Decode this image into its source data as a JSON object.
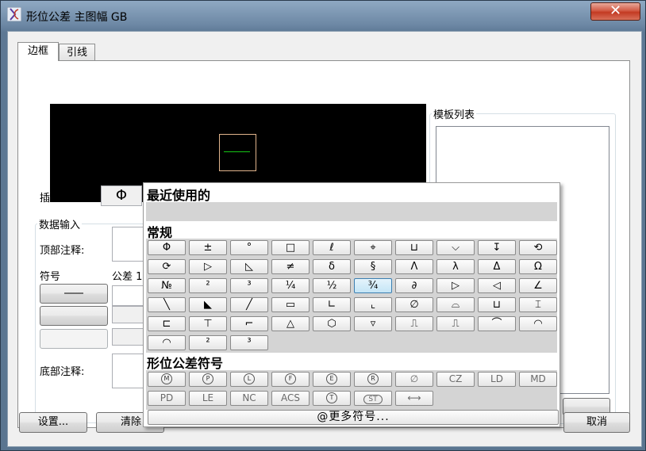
{
  "window": {
    "title": "形位公差 主图幅 GB",
    "close_glyph": "✕"
  },
  "tabs": [
    {
      "label": "边框"
    },
    {
      "label": "引线"
    }
  ],
  "form": {
    "insert_label": "插入符",
    "insert_symbol": "Φ",
    "data_input_group": "数据输入",
    "top_note_label": "顶部注释:",
    "symbol_label": "符号",
    "tolerance_label": "公差 1",
    "bottom_note_label": "底部注释:",
    "template_list_label": "模板列表"
  },
  "buttons": {
    "settings": "设置...",
    "clear": "清除",
    "cancel": "取消"
  },
  "popup": {
    "recent_title": "最近使用的",
    "normal_title": "常规",
    "gdt_title": "形位公差符号",
    "more_label": "@更多符号...",
    "normal_rows": [
      [
        "Φ",
        "±",
        "°",
        "□",
        "ℓ",
        "⌖",
        "⊔",
        "⌵",
        "↧",
        "⟲"
      ],
      [
        "⟳",
        "▷",
        "◺",
        "≠",
        "δ",
        "§",
        "Λ",
        "λ",
        "Δ",
        "Ω"
      ],
      [
        "№",
        "²",
        "³",
        "¼",
        "½",
        "¾",
        "∂",
        "▷",
        "◁",
        "∠"
      ],
      [
        "╲",
        "◣",
        "╱",
        "▭",
        "∟",
        "⌞",
        "∅",
        "⌓",
        "⊔",
        "⌶"
      ],
      [
        "⊏",
        "⊤",
        "⌐",
        "△",
        "⬡",
        "▿",
        "⎍",
        "⎍",
        "⌒",
        "◠"
      ],
      [
        "◠",
        "²",
        "³"
      ]
    ],
    "gdt_rows": [
      [
        "M",
        "P",
        "L",
        "F",
        "E",
        "R",
        "∅",
        "CZ",
        "LD",
        "MD"
      ],
      [
        "PD",
        "LE",
        "NC",
        "ACS",
        "T",
        "ST",
        "⟷"
      ]
    ]
  },
  "colors": {
    "titlebar": "#6d88a5",
    "close": "#c33a22",
    "selected_cell": "#c4e5f6"
  }
}
